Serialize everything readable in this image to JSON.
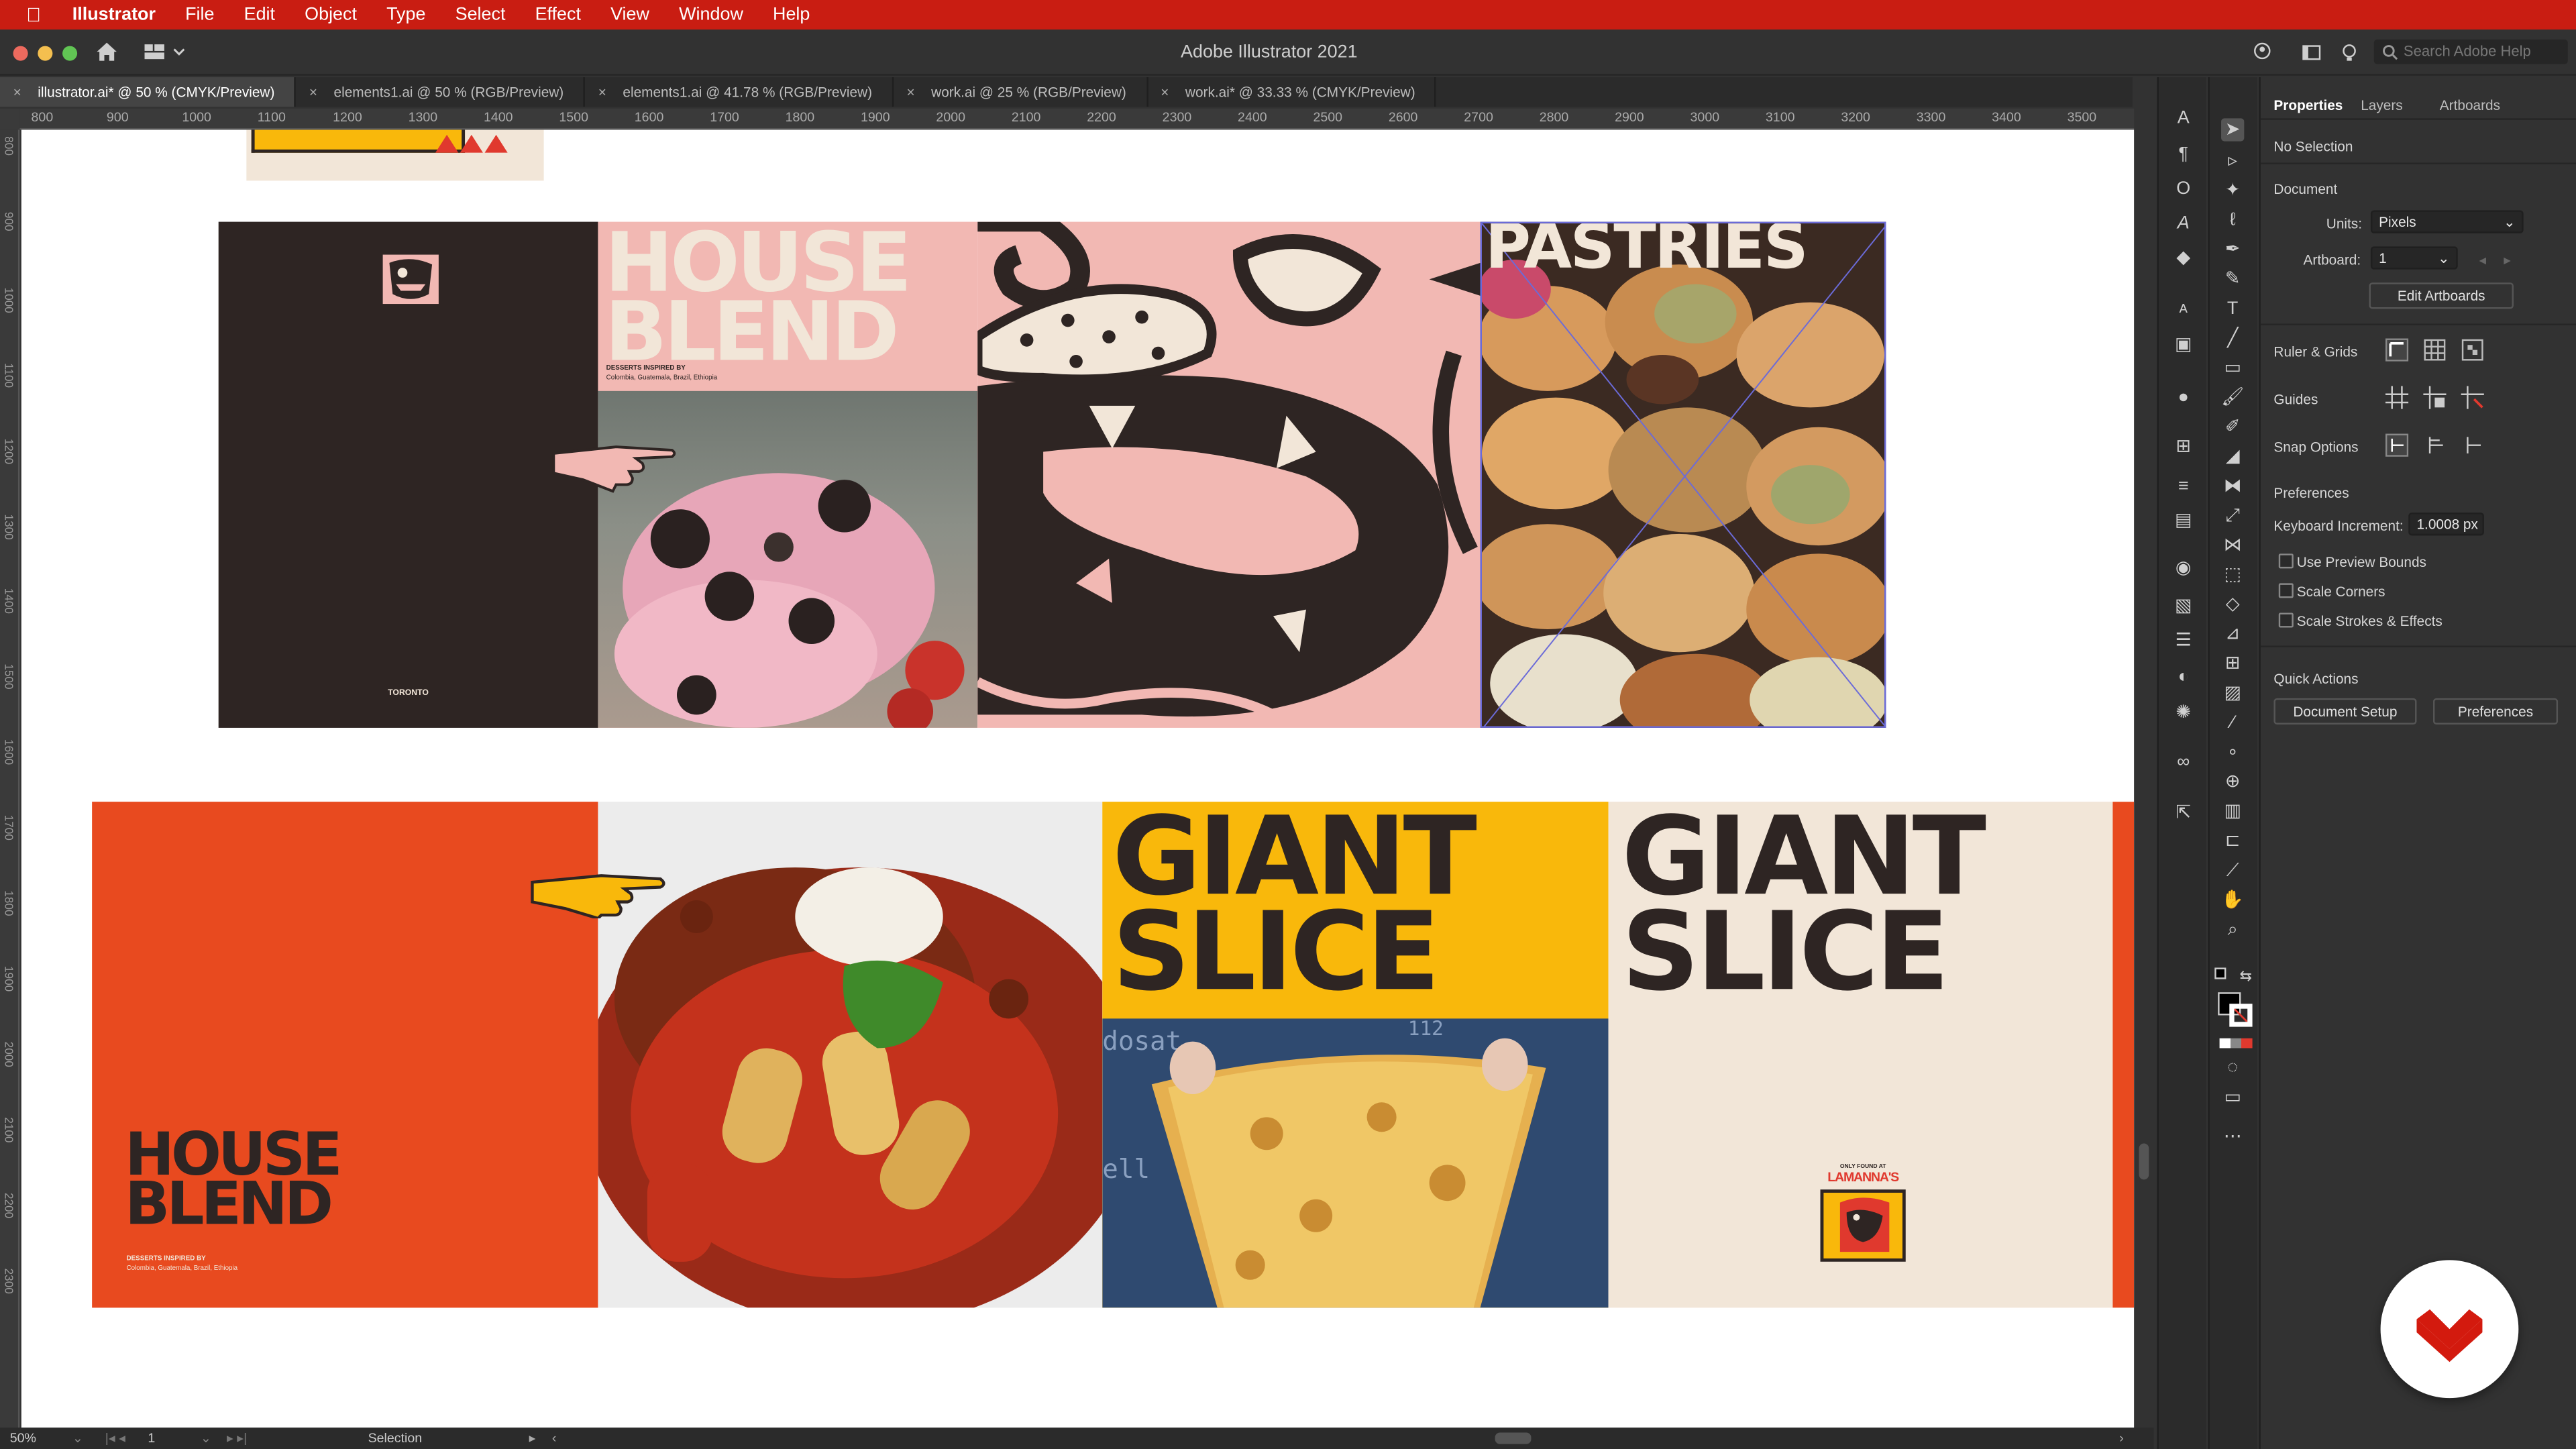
{
  "menubar": {
    "app_name": "Illustrator",
    "items": [
      "File",
      "Edit",
      "Object",
      "Type",
      "Select",
      "Effect",
      "View",
      "Window",
      "Help"
    ]
  },
  "window": {
    "title": "Adobe Illustrator 2021",
    "search_placeholder": "Search Adobe Help"
  },
  "tabs": [
    {
      "label": "illustrator.ai* @ 50 % (CMYK/Preview)",
      "active": true
    },
    {
      "label": "elements1.ai @ 50 % (RGB/Preview)",
      "active": false
    },
    {
      "label": "elements1.ai @ 41.78 % (RGB/Preview)",
      "active": false
    },
    {
      "label": "work.ai @ 25 % (RGB/Preview)",
      "active": false
    },
    {
      "label": "work.ai* @ 33.33 % (CMYK/Preview)",
      "active": false
    }
  ],
  "ruler": {
    "h_ticks": [
      "800",
      "900",
      "1000",
      "1100",
      "1200",
      "1300",
      "1400",
      "1500",
      "1600",
      "1700",
      "1800",
      "1900",
      "2000",
      "2100",
      "2200",
      "2300",
      "2400",
      "2500",
      "2600",
      "2700",
      "2800",
      "2900",
      "3000",
      "3100",
      "3200",
      "3300",
      "3400",
      "3500"
    ],
    "v_ticks": [
      "800",
      "900",
      "1000",
      "1100",
      "1200",
      "1300",
      "1400",
      "1500",
      "1600",
      "1700",
      "1800",
      "1900",
      "2000",
      "2100",
      "2200",
      "2300"
    ]
  },
  "status": {
    "zoom": "50%",
    "artboard": "1",
    "tool": "Selection"
  },
  "panel": {
    "tabs": [
      "Properties",
      "Layers",
      "Artboards"
    ],
    "selection": "No Selection",
    "document_title": "Document",
    "units_label": "Units:",
    "units_value": "Pixels",
    "artboard_label": "Artboard:",
    "artboard_value": "1",
    "edit_artboards": "Edit Artboards",
    "ruler_grids": "Ruler & Grids",
    "guides": "Guides",
    "snap_options": "Snap Options",
    "preferences_title": "Preferences",
    "keyboard_increment_label": "Keyboard Increment:",
    "keyboard_increment_value": "1.0008 px",
    "use_preview_bounds": "Use Preview Bounds",
    "scale_corners": "Scale Corners",
    "scale_strokes": "Scale Strokes & Effects",
    "quick_actions": "Quick Actions",
    "document_setup": "Document Setup",
    "preferences_button": "Preferences"
  },
  "artwork": {
    "house_blend": "HOUSE BLEND",
    "house": "HOUSE",
    "blend": "BLEND",
    "desserts_line1": "DESSERTS INSPIRED BY",
    "desserts_line2": "Colombia, Guatemala, Brazil, Ethiopia",
    "toronto": "TORONTO",
    "pastries": "PASTRIES",
    "giant": "GIANT",
    "slice": "SLICE",
    "only_found_at": "ONLY FOUND AT",
    "lamannas": "LAMANNA'S",
    "pizza_menu_text_1": "dosat",
    "pizza_menu_text_2": "ell",
    "pizza_menu_text_3": "112"
  },
  "colors": {
    "menubar": "#c91d12",
    "pink": "#f2b8b3",
    "dark": "#2e2523",
    "cream": "#f2e6d8",
    "orange": "#e84a1f",
    "yellow": "#f9b80b",
    "accent": "#e0392e"
  }
}
